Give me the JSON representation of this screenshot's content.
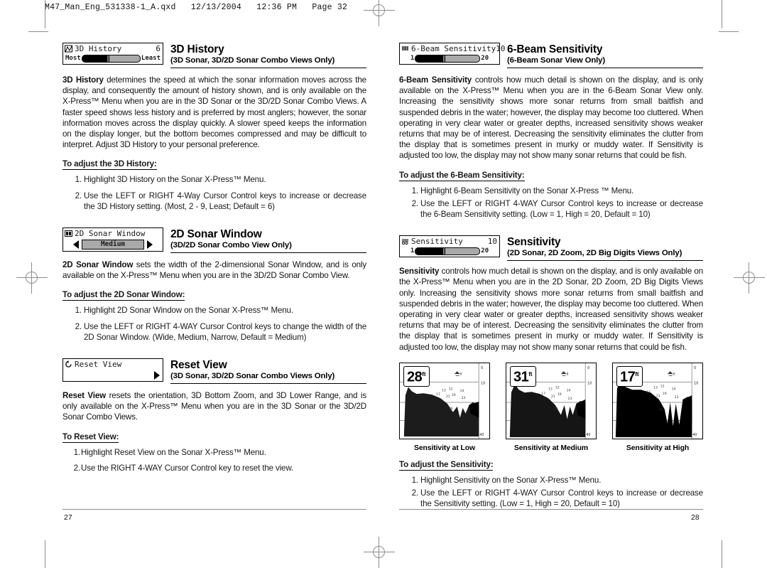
{
  "proof": {
    "header": "M47_Man_Eng_531338-1_A.qxd   12/13/2004   12:36 PM   Page 32"
  },
  "left_page": {
    "page_number": "27",
    "sections": [
      {
        "widget": {
          "icon": "3d-history-icon",
          "title": "3D History",
          "value": "6",
          "left_label": "Most",
          "right_label": "Least",
          "fill_percent": 42,
          "knob_percent": 42
        },
        "title": "3D History",
        "subtitle": "(3D Sonar, 3D/2D Sonar Combo Views Only)",
        "body_bold": "3D History",
        "body": " determines the speed at which the sonar information moves across the display, and consequently the amount of history shown, and is only available on the X-Press™ Menu when you are in the 3D Sonar or the 3D/2D Sonar Combo Views. A faster speed shows less history and is preferred by most anglers; however, the sonar information moves across the display quickly. A slower speed keeps the information on the display longer, but the bottom becomes compressed and may be difficult to interpret. Adjust 3D History to your personal preference.",
        "howto": "To adjust the 3D History:",
        "steps": [
          "Highlight 3D History on the Sonar X-Press™ Menu.",
          "Use the LEFT or RIGHT 4-Way Cursor Control keys to increase or decrease the 3D History setting. (Most, 2 - 9, Least; Default = 6)"
        ]
      },
      {
        "widget": {
          "icon": "2d-sonar-window-icon",
          "title": "2D Sonar Window",
          "value": "",
          "choice": "Medium",
          "left_arrow": "◀",
          "right_arrow": "▶"
        },
        "title": "2D Sonar Window",
        "subtitle": "(3D/2D Sonar Combo View Only)",
        "body_bold": "2D Sonar Window",
        "body": " sets the width of the 2-dimensional Sonar Window, and is only available on the X-Press™ Menu when you are in the 3D/2D Sonar Combo View.",
        "howto": "To adjust the 2D Sonar Window:",
        "steps": [
          "Highlight 2D Sonar Window on the Sonar X-Press™ Menu.",
          "Use the LEFT or RIGHT 4-WAY Cursor Control keys to change the width  of the 2D Sonar Window. (Wide, Medium, Narrow, Default = Medium)"
        ]
      },
      {
        "widget": {
          "icon": "reset-view-icon",
          "title": "Reset View",
          "value": "",
          "right_arrow": "▶"
        },
        "title": "Reset View",
        "subtitle": "(3D Sonar, 3D/2D Sonar Combo Views Only)",
        "body_bold": "Reset View",
        "body": " resets the orientation, 3D Bottom Zoom, and 3D Lower Range, and is only available on the X-Press™ Menu when you are in the 3D Sonar or the 3D/2D Sonar Combo Views.",
        "howto": "To Reset View:",
        "steps": [
          "Highlight Reset View on the Sonar X-Press™ Menu.",
          "Use the RIGHT 4-WAY Cursor Control key to reset the view."
        ]
      }
    ]
  },
  "right_page": {
    "page_number": "28",
    "sections": [
      {
        "widget": {
          "icon": "six-beam-icon",
          "title": "6-Beam Sensitivity",
          "value": "10",
          "left_label": "1",
          "right_label": "20",
          "fill_percent": 42,
          "knob_percent": 42
        },
        "title": "6-Beam Sensitivity",
        "subtitle": "(6-Beam Sonar View Only)",
        "body_bold": "6-Beam Sensitivity",
        "body": " controls how much detail is shown on the display, and is only available on the X-Press™ Menu when you are in the 6-Beam Sonar View only. Increasing the sensitivity shows more sonar returns from small baitfish and suspended debris in the water; however, the display may become too cluttered. When operating in very clear water or greater depths, increased sensitivity shows weaker returns that may be of interest. Decreasing the sensitivity eliminates the clutter from the display that is sometimes present in murky or muddy water. If Sensitivity is adjusted too low, the display may not show many sonar returns that could be fish.",
        "howto": "To adjust the 6-Beam Sensitivity:",
        "steps": [
          "Highlight 6-Beam Sensitivity on the Sonar X-Press ™ Menu.",
          "Use the LEFT or RIGHT 4-WAY Cursor Control keys to increase or decrease the 6-Beam Sensitivity setting. (Low = 1, High = 20, Default = 10)"
        ]
      },
      {
        "widget": {
          "icon": "sensitivity-icon",
          "title": "Sensitivity",
          "value": "10",
          "left_label": "1",
          "right_label": "20",
          "fill_percent": 42,
          "knob_percent": 42
        },
        "title": "Sensitivity",
        "subtitle": "(2D Sonar, 2D Zoom, 2D Big Digits Views Only)",
        "body_bold": "Sensitivity",
        "body": " controls how much detail is shown on the display, and is only available on the X-Press™ Menu when you are in the 2D Sonar, 2D Zoom, 2D Big Digits Views only. Increasing the sensitivity shows more sonar returns from small baitfish and suspended debris in the water; however, the display may become too cluttered. When operating in very clear water or greater depths, increased sensitivity shows weaker returns that may be of interest. Decreasing the sensitivity eliminates the clutter from the display that is sometimes present in murky or muddy water. If Sensitivity is adjusted too low, the display may not show many sonar returns that could be fish.",
        "howto": "To adjust the Sensitivity:",
        "steps": [
          "Highlight Sensitivity on the Sonar X-Press™ Menu.",
          "Use the LEFT or RIGHT 4-WAY Cursor Control keys to increase or decrease the Sensitivity setting. (Low = 1, High = 20, Default = 10)"
        ]
      }
    ],
    "figures": [
      {
        "depth": "28",
        "unit": "ft",
        "caption": "Sensitivity at Low",
        "density": "low"
      },
      {
        "depth": "31",
        "unit": "ft",
        "caption": "Sensitivity at Medium",
        "density": "medium"
      },
      {
        "depth": "17",
        "unit": "ft",
        "caption": "Sensitivity at High",
        "density": "high"
      }
    ],
    "figure_scale": {
      "top": "0",
      "mid": "10",
      "bottom": "40"
    }
  }
}
